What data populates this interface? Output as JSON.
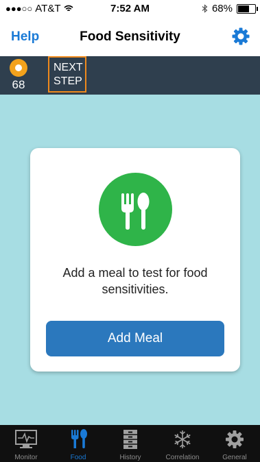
{
  "status": {
    "carrier": "AT&T",
    "signal_dots": "●●●○○",
    "time": "7:52 AM",
    "battery": "68%",
    "battery_level": 0.68
  },
  "nav": {
    "help": "Help",
    "title": "Food Sensitivity",
    "settings_icon": "gear-icon"
  },
  "stepbar": {
    "score": "68",
    "next_step": "NEXT STEP",
    "sun_icon": "sun-icon"
  },
  "card": {
    "icon": "fork-spoon-icon",
    "message": "Add a meal to test for food sensitivities.",
    "button": "Add Meal"
  },
  "tabs": [
    {
      "label": "Monitor",
      "icon": "monitor-icon",
      "active": false
    },
    {
      "label": "Food",
      "icon": "fork-spoon-icon",
      "active": true
    },
    {
      "label": "History",
      "icon": "cabinet-icon",
      "active": false
    },
    {
      "label": "Correlation",
      "icon": "snowflake-icon",
      "active": false
    },
    {
      "label": "General",
      "icon": "gear-icon",
      "active": false
    }
  ],
  "colors": {
    "accent_blue": "#1a7ad6",
    "step_bar": "#2f3f4e",
    "highlight_orange": "#f08a1c",
    "background_teal": "#a7dde3",
    "food_green": "#2fb449",
    "button_blue": "#2b78bd"
  }
}
